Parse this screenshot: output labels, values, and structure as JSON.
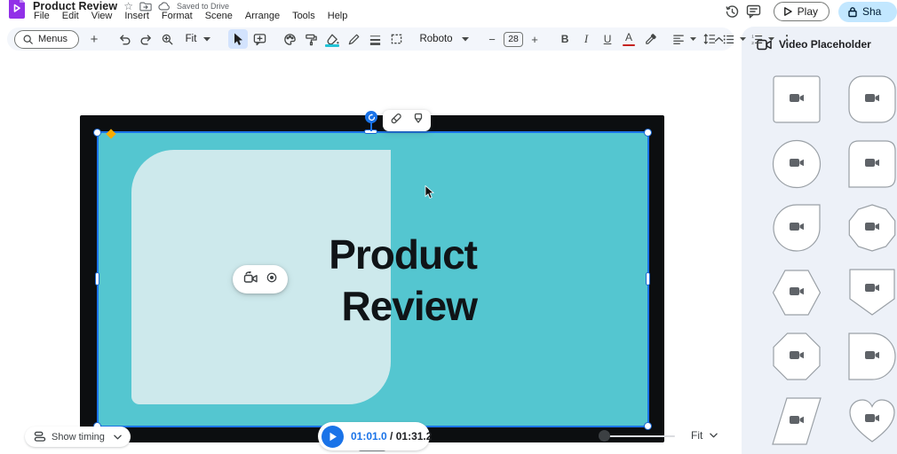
{
  "header": {
    "title": "Product Review",
    "saved_status": "Saved to Drive",
    "menus": [
      "File",
      "Edit",
      "View",
      "Insert",
      "Format",
      "Scene",
      "Arrange",
      "Tools",
      "Help"
    ],
    "play_label": "Play",
    "share_label": "Sha"
  },
  "toolbar": {
    "menus_label": "Menus",
    "zoom_fit_label": "Fit",
    "font_name": "Roboto",
    "font_size": "28",
    "bold_label": "B",
    "italic_label": "I",
    "underline_label": "U",
    "text_color_label": "A"
  },
  "icons": {
    "star": "☆",
    "add": "+",
    "minus": "−",
    "plus": "+",
    "more_vert": "⋮"
  },
  "sidebar": {
    "title": "Video Placeholder",
    "shapes": [
      "square",
      "rounded-square",
      "circle",
      "rounded-square-sharp-corner",
      "teardrop",
      "decagon",
      "hexagon",
      "banner",
      "octagon",
      "d-shape",
      "parallelogram",
      "heart"
    ]
  },
  "canvas": {
    "slide_title": [
      "Product",
      "Review"
    ],
    "colors": {
      "slide_teal": "#54C6D0",
      "panel_teal": "#CDE9EC",
      "frame_black": "#0C0E10",
      "selection_blue": "#1A73E8",
      "diamond_orange": "#F9AB00"
    }
  },
  "bottom_bar": {
    "show_timing_label": "Show timing",
    "current_time": "01:01.0",
    "time_separator": " / ",
    "total_time": "01:31.2",
    "zoom_fit_label": "Fit"
  }
}
